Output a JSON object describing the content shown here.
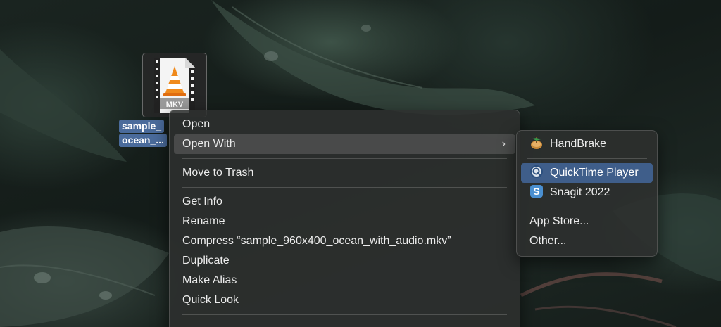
{
  "desktop": {
    "file": {
      "badge": "MKV",
      "label_line1": "sample_",
      "label_line2": "ocean_...",
      "icon": "vlc-cone-icon"
    }
  },
  "context_menu": {
    "items": [
      {
        "label": "Open"
      },
      {
        "label": "Open With",
        "has_submenu": true,
        "state": "hover"
      },
      {
        "label": "Move to Trash"
      },
      {
        "label": "Get Info"
      },
      {
        "label": "Rename"
      },
      {
        "label": "Compress “sample_960x400_ocean_with_audio.mkv”"
      },
      {
        "label": "Duplicate"
      },
      {
        "label": "Make Alias"
      },
      {
        "label": "Quick Look"
      }
    ]
  },
  "open_with_submenu": {
    "apps": [
      {
        "label": "HandBrake",
        "icon": "handbrake-icon"
      },
      {
        "label": "QuickTime Player",
        "icon": "quicktime-icon",
        "state": "selected"
      },
      {
        "label": "Snagit 2022",
        "icon": "snagit-icon"
      }
    ],
    "extra": [
      {
        "label": "App Store..."
      },
      {
        "label": "Other..."
      }
    ]
  },
  "colors": {
    "selection_accent": "#3f5e8a",
    "hover": "#5a5a5a",
    "menu_bg": "#2e302f"
  }
}
